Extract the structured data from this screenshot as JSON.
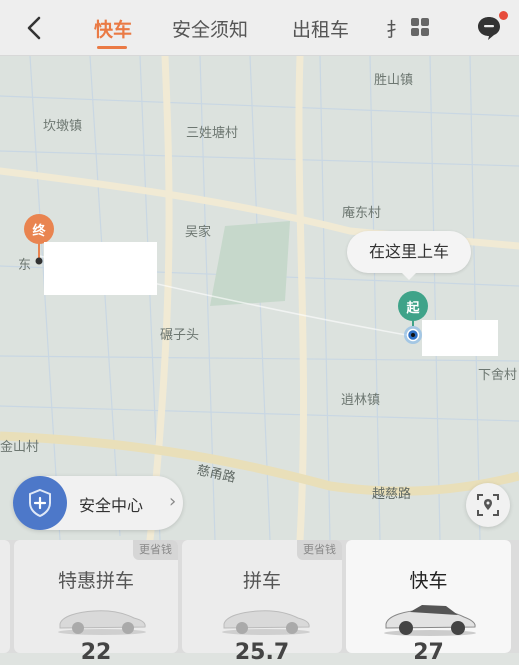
{
  "header": {
    "tabs": [
      {
        "label": "快车",
        "active": true
      },
      {
        "label": "安全须知",
        "active": false
      },
      {
        "label": "出租车",
        "active": false
      },
      {
        "label": "扌",
        "active": false
      }
    ]
  },
  "map": {
    "places": [
      "胜山镇",
      "坎墩镇",
      "三姓塘村",
      "庵东村",
      "吴家",
      "碾子头",
      "逍林镇",
      "下舍村",
      "金山村",
      "东"
    ],
    "roads": [
      "慈甬路",
      "越慈路"
    ],
    "end_pin": "终",
    "start_pin": "起",
    "pickup_bubble": "在这里上车"
  },
  "safety": {
    "label": "安全中心"
  },
  "cards": [
    {
      "title": "特惠拼车",
      "tag": "更省钱",
      "price": "22"
    },
    {
      "title": "拼车",
      "tag": "更省钱",
      "price": "25.7"
    },
    {
      "title": "快车",
      "tag": "",
      "price": "27"
    }
  ],
  "colors": {
    "accent": "#ea7a45",
    "start": "#3fa389",
    "end": "#e98450",
    "safety": "#4d78c9"
  }
}
